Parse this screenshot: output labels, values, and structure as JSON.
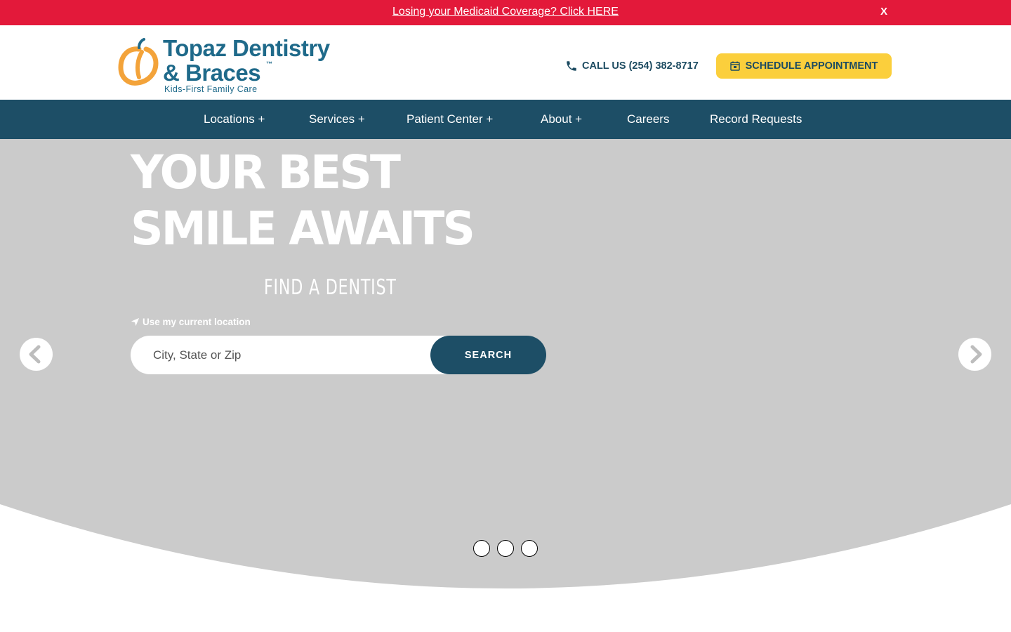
{
  "alert": {
    "text": "Losing your Medicaid Coverage? Click HERE",
    "close_label": "X"
  },
  "logo": {
    "line1": "Topaz Dentistry",
    "line2": "& Braces",
    "tm": "™",
    "tagline": "Kids-First Family Care"
  },
  "header": {
    "call_label": "CALL US (254) 382-8717",
    "schedule_label": "SCHEDULE APPOINTMENT"
  },
  "nav": {
    "items": [
      {
        "label": "Locations +"
      },
      {
        "label": "Services +"
      },
      {
        "label": "Patient Center +"
      },
      {
        "label": "About +"
      },
      {
        "label": "Careers"
      },
      {
        "label": "Record Requests"
      }
    ]
  },
  "hero": {
    "headline_line1": "YOUR BEST",
    "headline_line2": "SMILE AWAITS",
    "find_dentist": "FIND A DENTIST",
    "use_location": "Use my current location",
    "search_placeholder": "City, State or Zip",
    "search_button": "SEARCH",
    "slide_count": 3
  },
  "colors": {
    "alert_red": "#e3193a",
    "brand_blue": "#1d4e66",
    "logo_blue": "#1f6a8a",
    "accent_yellow": "#fbcf3c",
    "logo_orange": "#f3a33a",
    "hero_gray": "#cbcbcb"
  }
}
